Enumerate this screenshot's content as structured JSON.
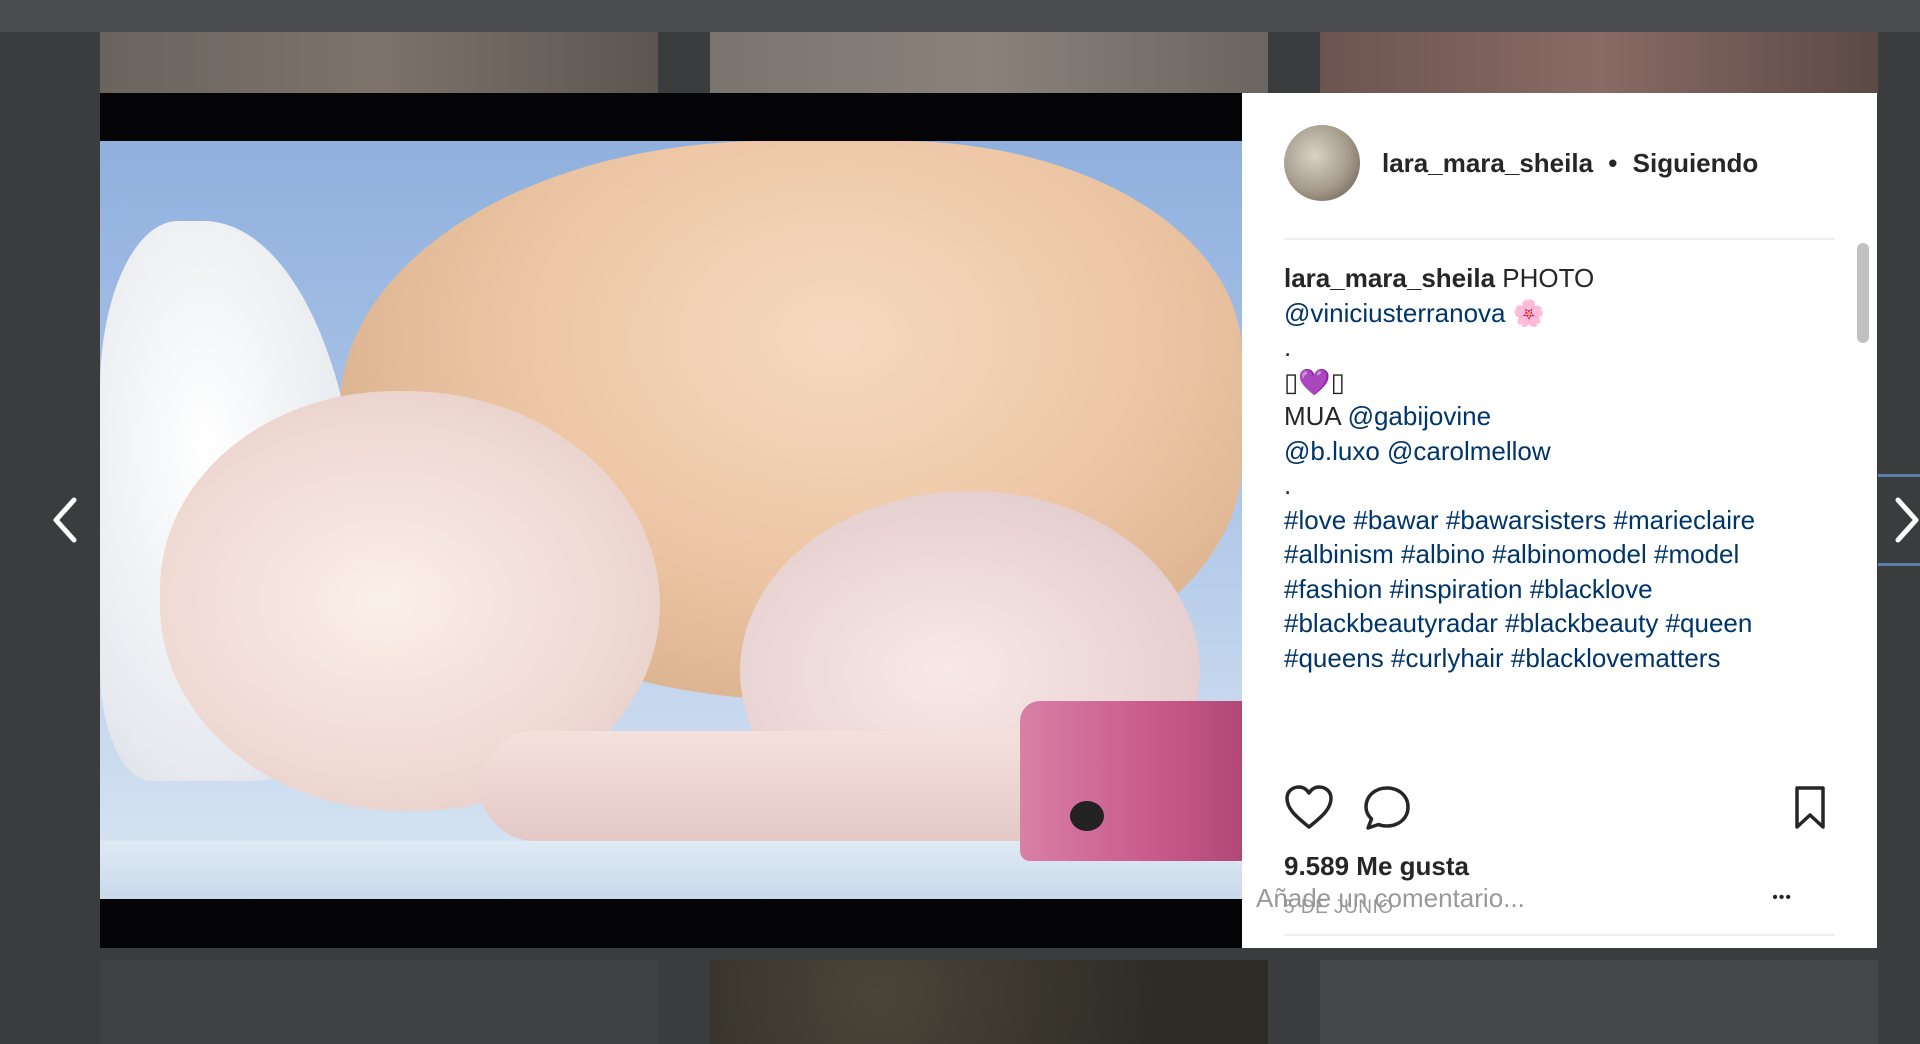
{
  "post": {
    "username": "lara_mara_sheila",
    "separator": "•",
    "follow_status": "Siguiendo",
    "caption": {
      "author": "lara_mara_sheila",
      "line1_text": "PHOTO",
      "photo_credit": "@viniciusterranova",
      "flower_emoji": "🌸",
      "dot1": ".",
      "heart_line": "▯💜▯",
      "mua_label": "MUA",
      "mua_handle": "@gabijovine",
      "handle2": "@b.luxo",
      "handle3": "@carolmellow",
      "dot2": ".",
      "hashtags_line1": "#love #bawar #bawarsisters #marieclaire",
      "hashtags_line2": "#albinism #albino #albinomodel #model",
      "hashtags_line3": "#fashion #inspiration #blacklove",
      "hashtags_line4": "#blackbeautyradar #blackbeauty #queen",
      "hashtags_line5": "#queens #curlyhair #blacklovematters"
    },
    "likes": "9.589 Me gusta",
    "date": "5 DE JUNIO",
    "comment_placeholder": "Añade un comentario...",
    "more_options": "•••"
  },
  "icons": {
    "like": "heart-icon",
    "comment": "comment-icon",
    "save": "bookmark-icon",
    "prev": "chevron-left-icon",
    "next": "chevron-right-icon"
  },
  "colors": {
    "link": "#003569",
    "text": "#262626",
    "muted": "#999999",
    "overlay": "#3a3c3e"
  }
}
